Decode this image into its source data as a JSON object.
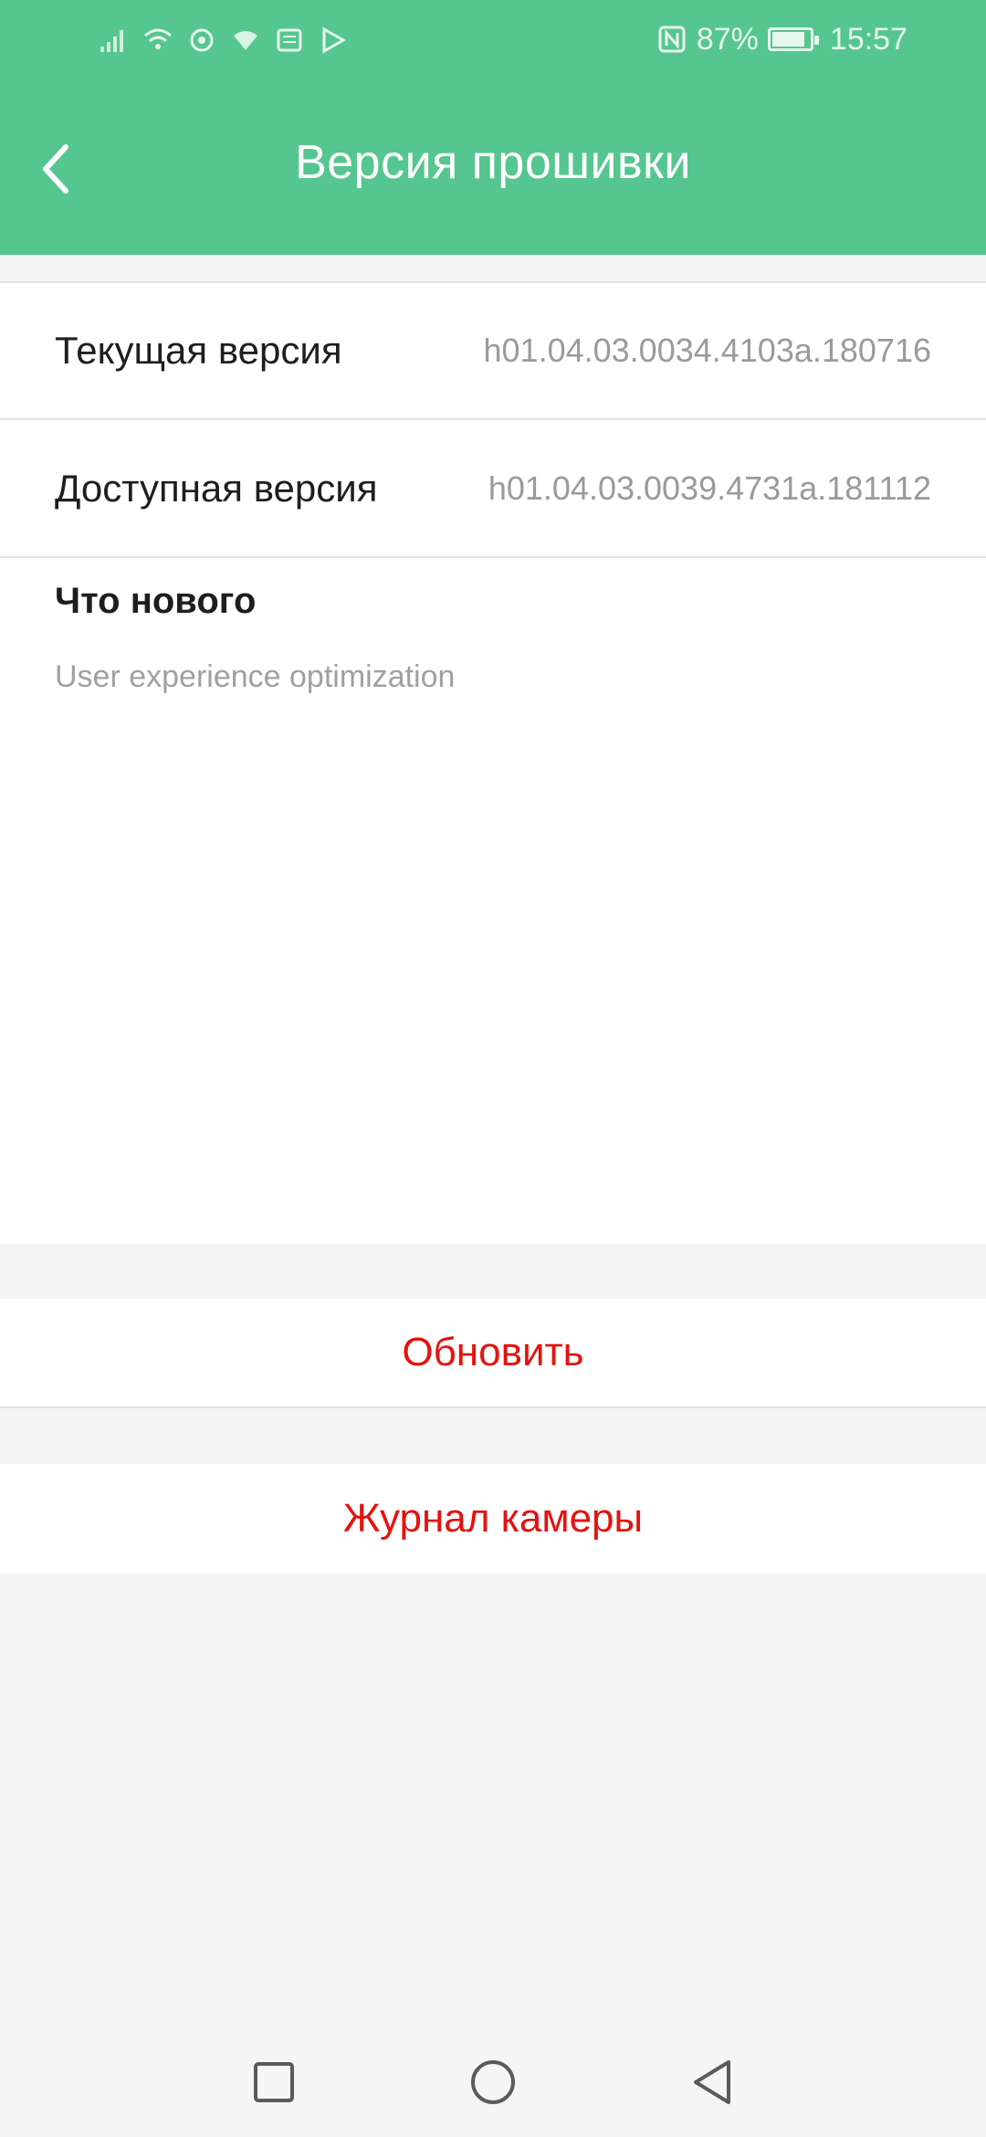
{
  "status_bar": {
    "battery_percent": "87%",
    "battery_level": 0.87,
    "time": "15:57",
    "icons": [
      "signal-icon",
      "wifi-calling-icon",
      "vpn-icon",
      "wifi-icon",
      "message-icon",
      "play-store-icon",
      "nfc-icon",
      "battery-icon"
    ]
  },
  "header": {
    "title": "Версия прошивки",
    "background_color": "#55c68f"
  },
  "firmware": {
    "current_label": "Текущая версия",
    "current_value": "h01.04.03.0034.4103a.180716",
    "available_label": "Доступная версия",
    "available_value": "h01.04.03.0039.4731a.181112"
  },
  "whats_new": {
    "title": "Что нового",
    "text": "User experience optimization"
  },
  "actions": {
    "update_label": "Обновить",
    "camera_log_label": "Журнал камеры",
    "accent_color": "#e3130f"
  },
  "nav_bar": {
    "icons": [
      "recents-icon",
      "home-icon",
      "back-nav-icon"
    ]
  }
}
